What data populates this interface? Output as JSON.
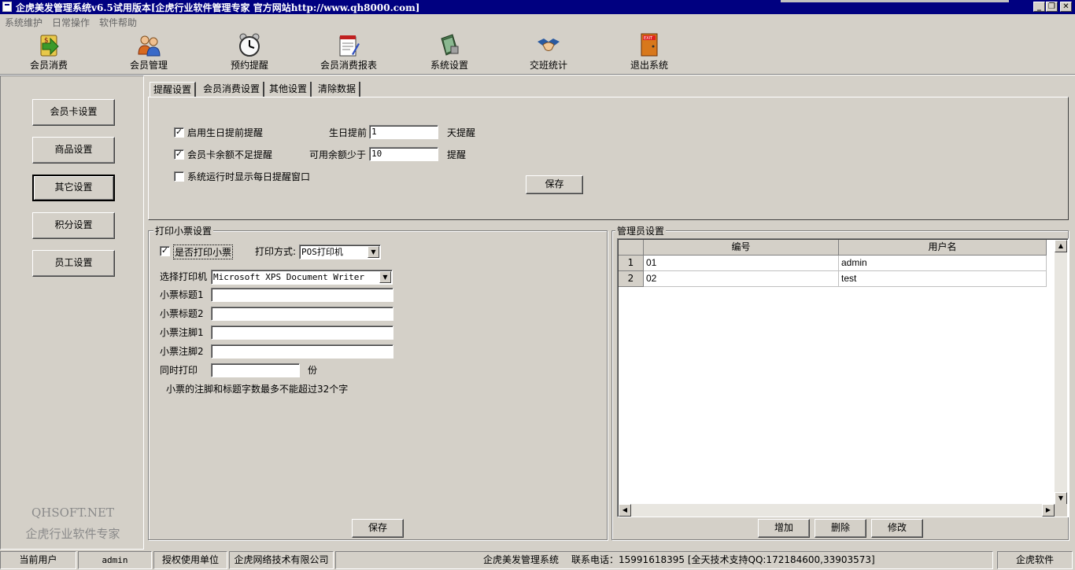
{
  "window": {
    "title": "企虎美发管理系统v6.5试用版本[企虎行业软件管理专家 官方网站http://www.qh8000.com]",
    "controls": {
      "minimize": "_",
      "restore": "❐",
      "close": "✕"
    }
  },
  "menu": [
    "系统维护",
    "日常操作",
    "软件帮助"
  ],
  "toolbar": [
    {
      "label": "会员消费",
      "icon": "member-consume-icon"
    },
    {
      "label": "会员管理",
      "icon": "member-manage-icon"
    },
    {
      "label": "预约提醒",
      "icon": "alarm-clock-icon"
    },
    {
      "label": "会员消费报表",
      "icon": "report-icon"
    },
    {
      "label": "系统设置",
      "icon": "settings-book-icon"
    },
    {
      "label": "交班统计",
      "icon": "handshake-icon"
    },
    {
      "label": "退出系统",
      "icon": "exit-door-icon"
    }
  ],
  "sidebar": {
    "buttons": [
      "会员卡设置",
      "商品设置",
      "其它设置",
      "积分设置",
      "员工设置"
    ],
    "active_index": 2,
    "watermark_line1": "QHSOFT.NET",
    "watermark_line2": "企虎行业软件专家"
  },
  "tabs": [
    "提醒设置",
    "会员消费设置",
    "其他设置",
    "清除数据"
  ],
  "reminder": {
    "birthday_enable_label": "启用生日提前提醒",
    "birthday_enable_checked": true,
    "birthday_days_label": "生日提前",
    "birthday_days_value": "1",
    "birthday_days_suffix": "天提醒",
    "balance_enable_label": "会员卡余额不足提醒",
    "balance_enable_checked": true,
    "balance_threshold_label": "可用余额少于",
    "balance_threshold_value": "10",
    "balance_threshold_suffix": "提醒",
    "daily_popup_label": "系统运行时显示每日提醒窗口",
    "daily_popup_checked": false,
    "save_label": "保存"
  },
  "print": {
    "group_title": "打印小票设置",
    "enable_label": "是否打印小票",
    "enable_checked": true,
    "method_label": "打印方式:",
    "method_value": "POS打印机",
    "printer_label": "选择打印机",
    "printer_value": "Microsoft XPS Document Writer",
    "title1_label": "小票标题1",
    "title1_value": "",
    "title2_label": "小票标题2",
    "title2_value": "",
    "footer1_label": "小票注脚1",
    "footer1_value": "",
    "footer2_label": "小票注脚2",
    "footer2_value": "",
    "copies_label": "同时打印",
    "copies_value": "",
    "copies_suffix": "份",
    "note": "小票的注脚和标题字数最多不能超过32个字",
    "save_label": "保存"
  },
  "admin": {
    "group_title": "管理员设置",
    "columns": [
      "编号",
      "用户名"
    ],
    "rows": [
      {
        "index": "1",
        "id": "01",
        "username": "admin"
      },
      {
        "index": "2",
        "id": "02",
        "username": "test"
      }
    ],
    "add_label": "增加",
    "delete_label": "删除",
    "edit_label": "修改"
  },
  "status": {
    "user_label": "当前用户",
    "user_value": "admin",
    "license_label": "授权使用单位",
    "license_value": "企虎网络技术有限公司",
    "product": "企虎美发管理系统",
    "contact": "联系电话：15991618395  [全天技术支持QQ:172184600,33903573]",
    "brand": "企虎软件"
  }
}
